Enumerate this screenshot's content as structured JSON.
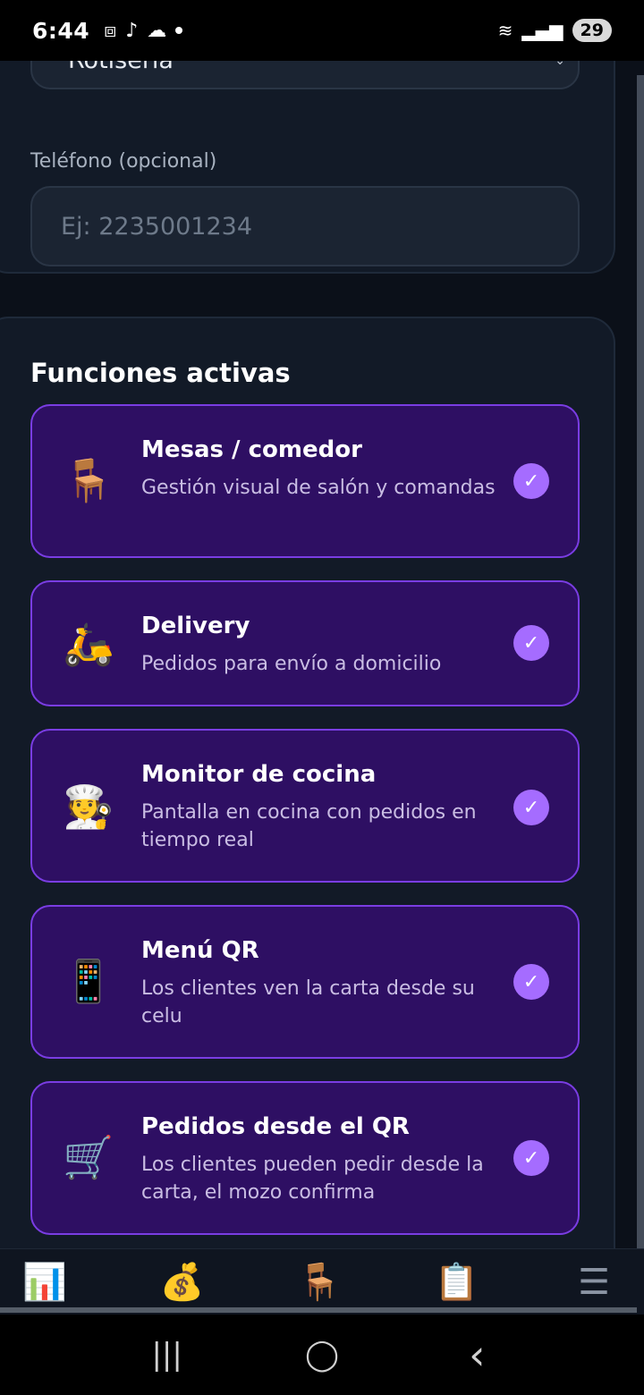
{
  "status_bar": {
    "time": "6:44",
    "battery": "29",
    "icons": [
      "screenshot-icon",
      "tiktok-icon",
      "weather-icon",
      "wifi-icon",
      "signal-icon"
    ]
  },
  "business": {
    "type_value": "Rotisería",
    "phone_label": "Teléfono (opcional)",
    "phone_placeholder": "Ej: 2235001234",
    "phone_value": ""
  },
  "features": {
    "title": "Funciones activas",
    "items": [
      {
        "icon": "🪑",
        "icon_name": "chair-icon",
        "title": "Mesas / comedor",
        "description": "Gestión visual de salón y comandas",
        "active": true
      },
      {
        "icon": "🛵",
        "icon_name": "scooter-icon",
        "title": "Delivery",
        "description": "Pedidos para envío a domicilio",
        "active": true
      },
      {
        "icon": "🧑‍🍳",
        "icon_name": "chef-icon",
        "title": "Monitor de cocina",
        "description": "Pantalla en cocina con pedidos en tiempo real",
        "active": true
      },
      {
        "icon": "📱",
        "icon_name": "phone-icon",
        "title": "Menú QR",
        "description": "Los clientes ven la carta desde su celu",
        "active": true
      },
      {
        "icon": "🛒",
        "icon_name": "cart-icon",
        "title": "Pedidos desde el QR",
        "description": "Los clientes pueden pedir desde la carta, el mozo confirma",
        "active": true
      }
    ],
    "check_glyph": "✓"
  },
  "bottom_nav": {
    "items": [
      {
        "icon": "📊",
        "name": "dashboard-icon"
      },
      {
        "icon": "💰",
        "name": "money-bag-icon"
      },
      {
        "icon": "🪑",
        "name": "tables-icon"
      },
      {
        "icon": "📋",
        "name": "orders-icon"
      },
      {
        "icon": "☰",
        "name": "menu-icon"
      }
    ]
  },
  "system_nav": {
    "recent": "|||",
    "home": "◯",
    "back": "‹"
  },
  "colors": {
    "card_bg": "#121a27",
    "feature_bg": "#2e0f63",
    "feature_border": "#7a3de3",
    "check_bg": "#a56cff"
  }
}
